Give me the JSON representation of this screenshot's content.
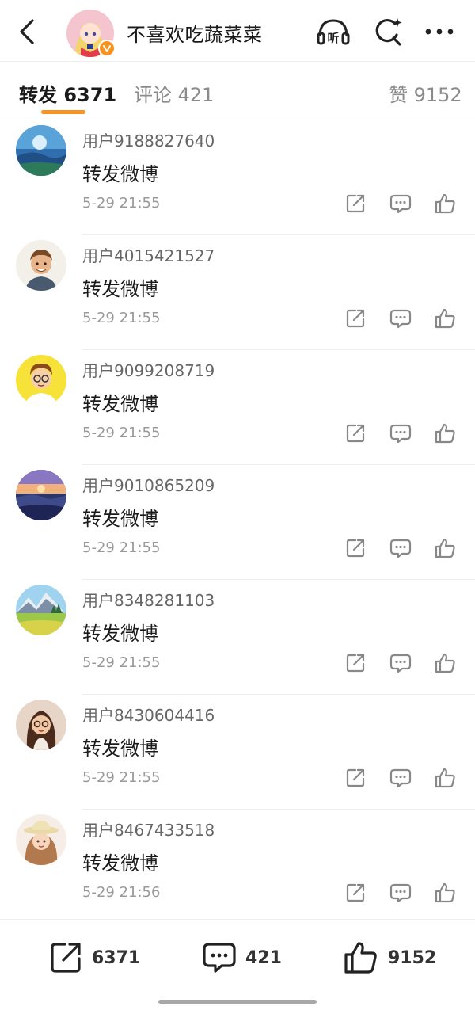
{
  "header": {
    "title": "不喜欢吃蔬菜菜",
    "listen_label": "听",
    "icons": [
      "back-icon",
      "listen-icon",
      "search-icon",
      "more-icon"
    ],
    "verified_color": "#f7931e"
  },
  "tabs": [
    {
      "label": "转发 6371",
      "active": true
    },
    {
      "label": "评论 421",
      "active": false
    },
    {
      "label": "赞 9152",
      "active": false
    }
  ],
  "accent_color": "#f7931e",
  "reposts": [
    {
      "user": "用户9188827640",
      "text": "转发微博",
      "time": "5-29 21:55"
    },
    {
      "user": "用户4015421527",
      "text": "转发微博",
      "time": "5-29 21:55"
    },
    {
      "user": "用户9099208719",
      "text": "转发微博",
      "time": "5-29 21:55"
    },
    {
      "user": "用户9010865209",
      "text": "转发微博",
      "time": "5-29 21:55"
    },
    {
      "user": "用户8348281103",
      "text": "转发微博",
      "time": "5-29 21:55"
    },
    {
      "user": "用户8430604416",
      "text": "转发微博",
      "time": "5-29 21:55"
    },
    {
      "user": "用户8467433518",
      "text": "转发微博",
      "time": "5-29 21:56"
    }
  ],
  "bottom_bar": {
    "repost_count": "6371",
    "comment_count": "421",
    "like_count": "9152"
  }
}
